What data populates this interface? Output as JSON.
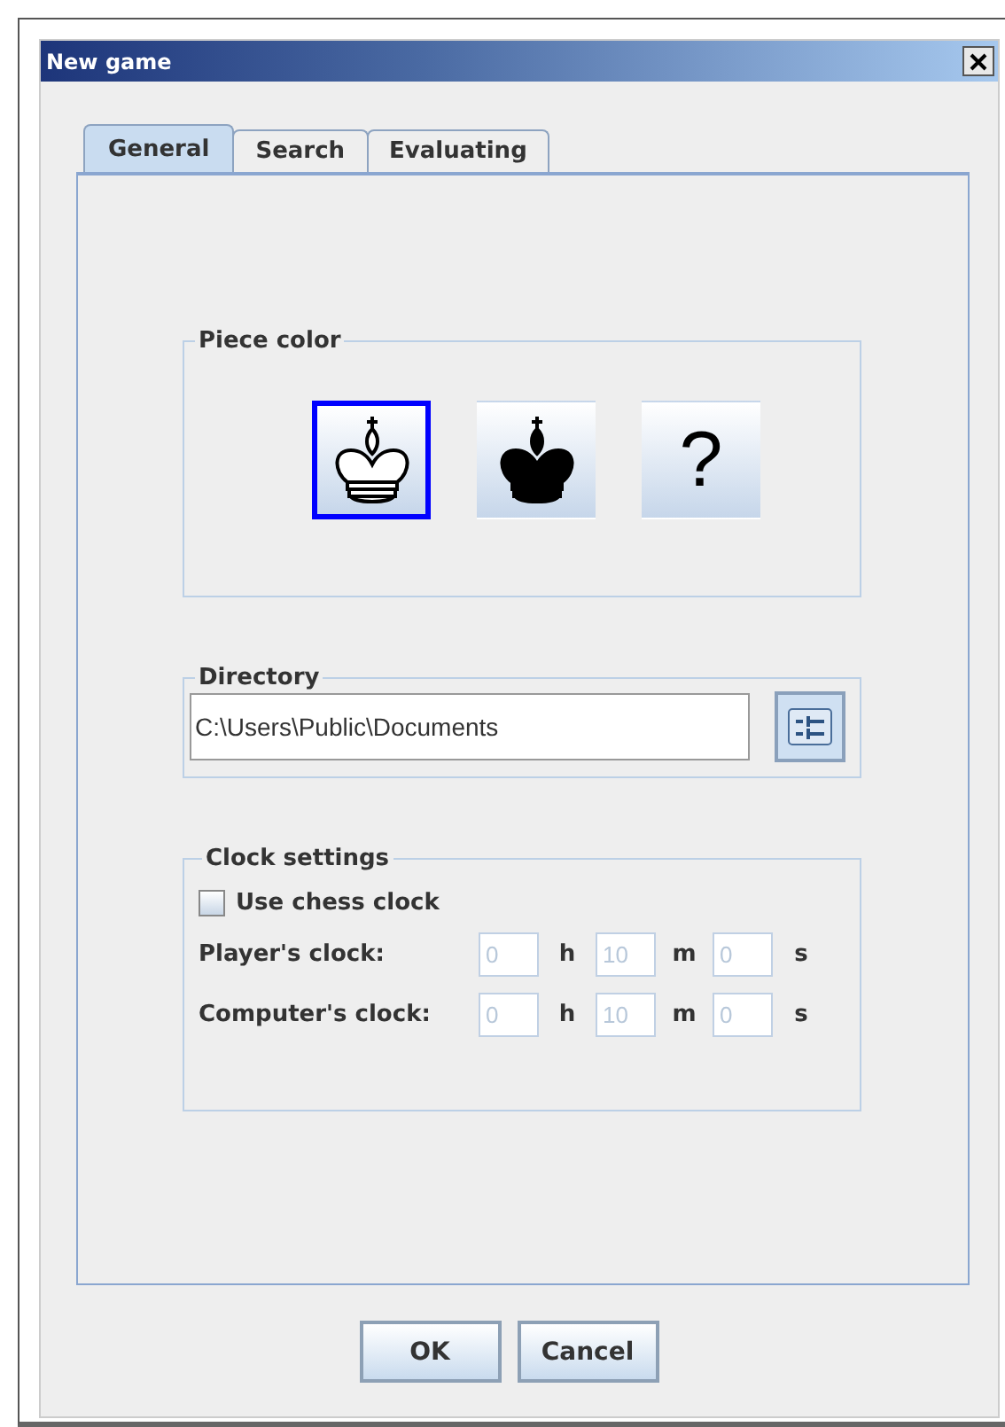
{
  "window": {
    "title": "New game"
  },
  "tabs": [
    {
      "label": "General",
      "selected": true
    },
    {
      "label": "Search",
      "selected": false
    },
    {
      "label": "Evaluating",
      "selected": false
    }
  ],
  "piece_color": {
    "title": "Piece color",
    "options": [
      {
        "kind": "white-king",
        "selected": true
      },
      {
        "kind": "black-king",
        "selected": false
      },
      {
        "kind": "random",
        "label": "?",
        "selected": false
      }
    ]
  },
  "directory": {
    "title": "Directory",
    "value": "C:\\Users\\Public\\Documents"
  },
  "clock": {
    "title": "Clock settings",
    "use_clock": {
      "label": "Use chess clock",
      "checked": false
    },
    "rows": [
      {
        "label": "Player's clock:",
        "disabled": true,
        "fields": [
          {
            "value": "0",
            "unit": "h"
          },
          {
            "value": "10",
            "unit": "m"
          },
          {
            "value": "0",
            "unit": "s"
          }
        ]
      },
      {
        "label": "Computer's clock:",
        "disabled": true,
        "fields": [
          {
            "value": "0",
            "unit": "h"
          },
          {
            "value": "10",
            "unit": "m"
          },
          {
            "value": "0",
            "unit": "s"
          }
        ]
      }
    ]
  },
  "buttons": [
    "OK",
    "Cancel"
  ]
}
